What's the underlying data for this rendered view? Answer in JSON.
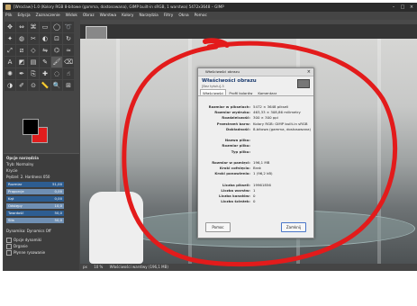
{
  "window": {
    "title": "[Wroclaw]-1.0 (Kolory RGB 8-bitowe (gamma, dostosowana), GIMP built-in sRGB, 1 warstwa) 5472x3648 – GIMP"
  },
  "menubar": [
    "Plik",
    "Edycja",
    "Zaznaczenie",
    "Widok",
    "Obraz",
    "Warstwa",
    "Kolory",
    "Narzędzia",
    "Filtry",
    "Okna",
    "Pomoc"
  ],
  "toolbox": {
    "tools": [
      "move-tool-icon",
      "align-tool-icon",
      "free-select-icon",
      "rect-select-icon",
      "ellipse-select-icon",
      "lasso-icon",
      "fuzzy-select-icon",
      "color-select-icon",
      "scissors-icon",
      "foreground-select-icon",
      "crop-icon",
      "rotate-icon",
      "scale-icon",
      "shear-icon",
      "perspective-icon",
      "flip-icon",
      "cage-icon",
      "warp-icon",
      "text-icon",
      "bucket-fill-icon",
      "gradient-icon",
      "pencil-icon",
      "paintbrush-icon",
      "eraser-icon",
      "airbrush-icon",
      "ink-icon",
      "clone-icon",
      "heal-icon",
      "blur-icon",
      "smudge-icon",
      "dodge-icon",
      "path-icon",
      "color-picker-icon",
      "measure-icon",
      "zoom-icon",
      "unified-transform-icon"
    ],
    "fg_color": "#000000",
    "bg_color": "#e11d1d"
  },
  "tool_options": {
    "title": "Opcje narzędzia",
    "mode_label": "Tryb",
    "mode_value": "Normalny",
    "opacity_label": "Krycie",
    "brush_label": "Pędzel",
    "brush_value": "2. Hardness 050",
    "sliders": [
      {
        "label": "Rozmiar",
        "value": "51,00"
      },
      {
        "label": "Proporcje",
        "value": "0,00"
      },
      {
        "label": "Kąt",
        "value": "0,00"
      },
      {
        "label": "Odstępy",
        "value": "10,0"
      },
      {
        "label": "Twardość",
        "value": "50,0"
      },
      {
        "label": "Siła",
        "value": "50,0"
      }
    ],
    "dynamics_label": "Dynamika",
    "dynamics_value": "Dynamics Off",
    "checkboxes": [
      "Opcje dynamiki",
      "Drganie",
      "Płynne rysowanie"
    ]
  },
  "status": {
    "unit": "px",
    "zoom": "10 %",
    "message": "Właściwości warstwy (196,1 MB)"
  },
  "dialog": {
    "window_title": "Właściwości obrazu",
    "header": "Właściwości obrazu",
    "subheader": "[Bez tytułu]-3",
    "tabs": [
      "Właściwości",
      "Profil kolorów",
      "Komentarz"
    ],
    "rows": [
      {
        "k": "Rozmiar w pikselach:",
        "v": "5472 × 3648 pikseli"
      },
      {
        "k": "Rozmiar wydruku:",
        "v": "463,33 × 308,86 milimetry"
      },
      {
        "k": "Rozdzielczość:",
        "v": "300 × 300 ppi"
      },
      {
        "k": "Przestrzeń barw:",
        "v": "Kolory RGB: GIMP built-in sRGB"
      },
      {
        "k": "Dokładność:",
        "v": "8-bitowa (gamma, dostosowana)"
      },
      {
        "k": "",
        "v": ""
      },
      {
        "k": "Nazwa pliku:",
        "v": ""
      },
      {
        "k": "Rozmiar pliku:",
        "v": ""
      },
      {
        "k": "Typ pliku:",
        "v": ""
      },
      {
        "k": "",
        "v": ""
      },
      {
        "k": "Rozmiar w pamięci:",
        "v": "196,1 MB"
      },
      {
        "k": "Kroki cofnięcia:",
        "v": "Brak"
      },
      {
        "k": "Kroki ponowienia:",
        "v": "1 (96,2 kB)"
      },
      {
        "k": "",
        "v": ""
      },
      {
        "k": "Liczba pikseli:",
        "v": "19961856"
      },
      {
        "k": "Liczba warstw:",
        "v": "1"
      },
      {
        "k": "Liczba kanałów:",
        "v": "0"
      },
      {
        "k": "Liczba ścieżek:",
        "v": "0"
      }
    ],
    "help_label": "Pomoc",
    "close_label": "Zamknij"
  },
  "annotation": {
    "color": "#e31b1b"
  }
}
